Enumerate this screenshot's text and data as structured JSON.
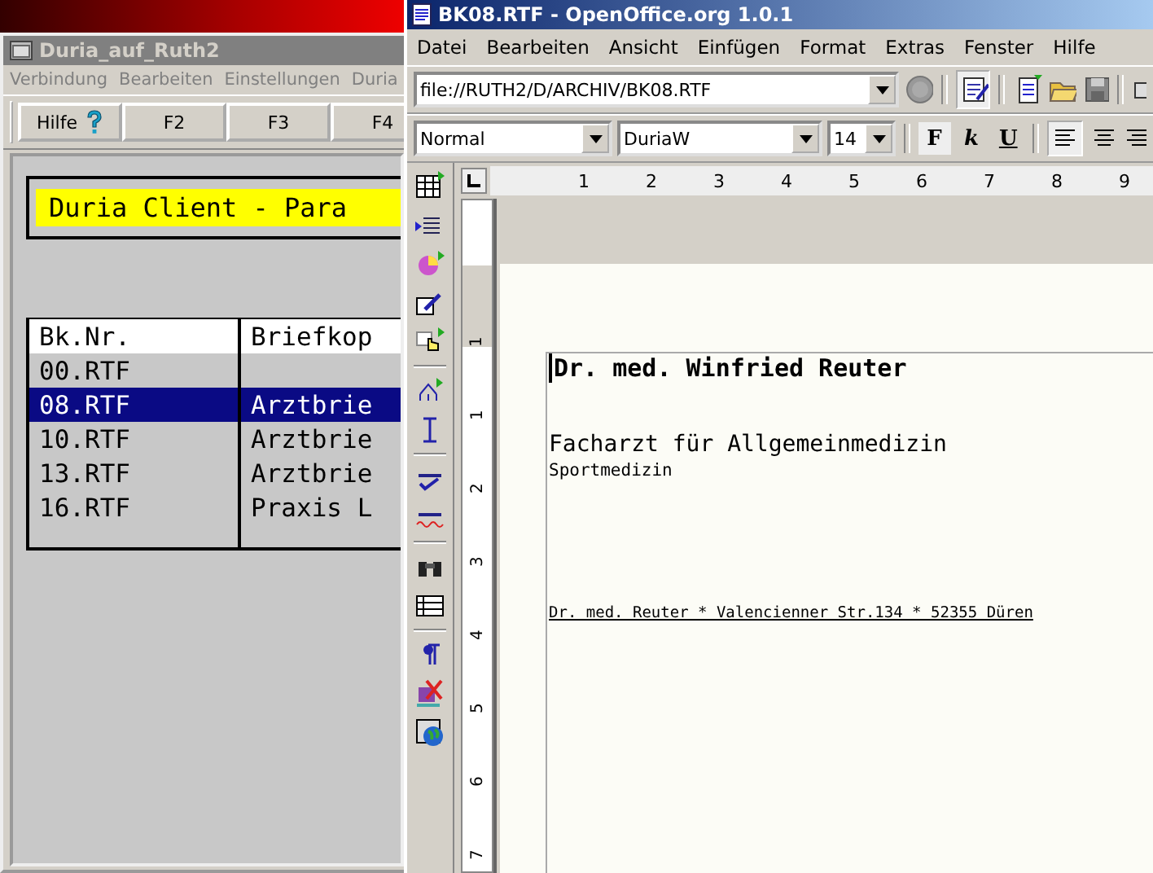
{
  "left_window": {
    "title": "Duria_auf_Ruth2",
    "menu": [
      "Verbindung",
      "Bearbeiten",
      "Einstellungen",
      "Duria"
    ],
    "toolbar": [
      {
        "label": "Hilfe",
        "kind": "help"
      },
      {
        "label": "F2",
        "kind": "plain"
      },
      {
        "label": "F3",
        "kind": "plain"
      },
      {
        "label": "F4",
        "kind": "plain"
      }
    ],
    "banner": "Duria Client - Para",
    "table": {
      "columns": [
        "Bk.Nr.",
        "Briefkop"
      ],
      "rows": [
        {
          "cells": [
            "00.RTF"
          ],
          "selected": false
        },
        {
          "cells": [
            "08.RTF",
            "Arztbrie"
          ],
          "selected": true
        },
        {
          "cells": [
            "10.RTF",
            "Arztbrie"
          ],
          "selected": false
        },
        {
          "cells": [
            "13.RTF",
            "Arztbrie"
          ],
          "selected": false
        },
        {
          "cells": [
            "16.RTF",
            "Praxis L"
          ],
          "selected": false
        }
      ]
    }
  },
  "right_window": {
    "title": "BK08.RTF - OpenOffice.org 1.0.1",
    "menu": [
      "Datei",
      "Bearbeiten",
      "Ansicht",
      "Einfügen",
      "Format",
      "Extras",
      "Fenster",
      "Hilfe"
    ],
    "url": "file://RUTH2/D/ARCHIV/BK08.RTF",
    "style": "Normal",
    "font": "DuriaW",
    "size": "14",
    "format_buttons": [
      "F",
      "k",
      "U"
    ],
    "ruler": [
      "1",
      "2",
      "3",
      "4",
      "5",
      "6",
      "7",
      "8",
      "9"
    ],
    "vruler": [
      "1",
      "1",
      "2",
      "3",
      "4",
      "5",
      "6",
      "7"
    ],
    "document": [
      {
        "text": "Dr. med. Winfried Reuter",
        "kind": "heading"
      },
      {
        "text": "Facharzt für Allgemeinmedizin",
        "kind": "subtitle"
      },
      {
        "text": "Sportmedizin",
        "kind": "small"
      },
      {
        "text": "Dr. med. Reuter * Valencienner Str.134 * 52355 Düren",
        "kind": "address"
      }
    ]
  }
}
